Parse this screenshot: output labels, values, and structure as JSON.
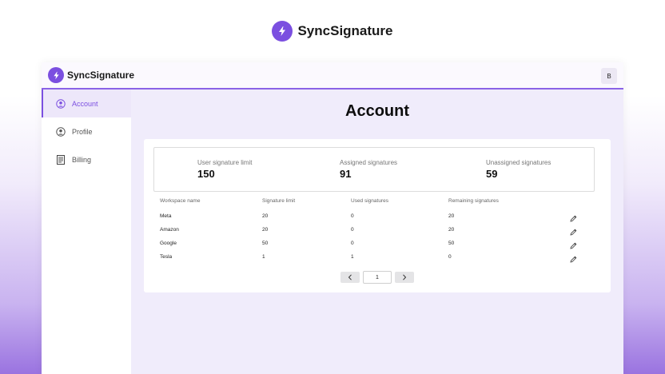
{
  "brand": {
    "name": "SyncSignature",
    "accent": "#7b4fe0"
  },
  "header": {
    "brand_name": "SyncSignature",
    "avatar_initial": "B"
  },
  "sidebar": {
    "items": [
      {
        "label": "Account",
        "icon": "user-circle-icon",
        "active": true
      },
      {
        "label": "Profile",
        "icon": "user-circle-icon",
        "active": false
      },
      {
        "label": "Billing",
        "icon": "receipt-icon",
        "active": false
      }
    ]
  },
  "main": {
    "title": "Account",
    "stats": [
      {
        "label": "User signature limit",
        "value": "150"
      },
      {
        "label": "Assigned signatures",
        "value": "91"
      },
      {
        "label": "Unassigned signatures",
        "value": "59"
      }
    ],
    "table": {
      "headers": [
        "Workspace name",
        "Signature limit",
        "Used signatures",
        "Remaining signatures"
      ],
      "rows": [
        [
          "Meta",
          "20",
          "0",
          "20"
        ],
        [
          "Amazon",
          "20",
          "0",
          "20"
        ],
        [
          "Google",
          "50",
          "0",
          "50"
        ],
        [
          "Tesla",
          "1",
          "1",
          "0"
        ]
      ]
    },
    "pagination": {
      "page": "1"
    }
  }
}
